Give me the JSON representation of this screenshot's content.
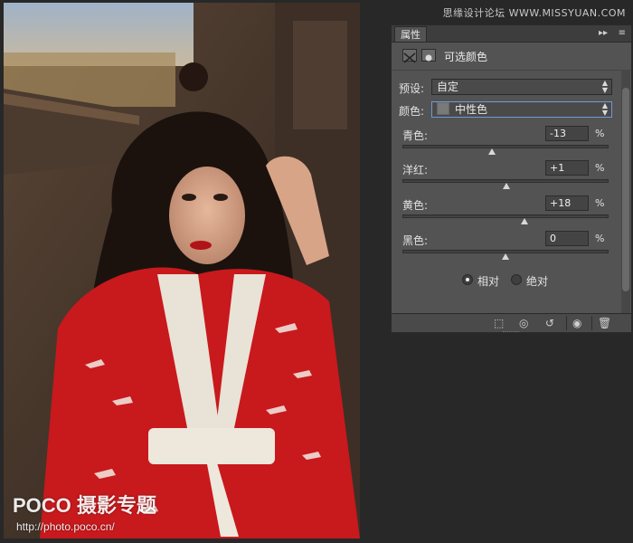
{
  "watermark_top": "思缘设计论坛  WWW.MISSYUAN.COM",
  "photo": {
    "brand": "POCO 摄影专题",
    "url": "http://photo.poco.cn/"
  },
  "panel": {
    "tab_label": "属性",
    "tab_controls": [
      "▸▸",
      "≡"
    ],
    "header_title": "可选颜色",
    "preset_label": "预设:",
    "preset_value": "自定",
    "colors_label": "颜色:",
    "colors_value": "中性色",
    "sliders": [
      {
        "label": "青色:",
        "value": "-13",
        "unit": "%",
        "amount": -13
      },
      {
        "label": "洋红:",
        "value": "+1",
        "unit": "%",
        "amount": 1
      },
      {
        "label": "黄色:",
        "value": "+18",
        "unit": "%",
        "amount": 18
      },
      {
        "label": "黑色:",
        "value": "0",
        "unit": "%",
        "amount": 0
      }
    ],
    "method_relative": "相对",
    "method_absolute": "绝对",
    "method_selected": "relative",
    "footer": [
      "⬚",
      "◎",
      "↺",
      "◉",
      "🗑"
    ]
  }
}
